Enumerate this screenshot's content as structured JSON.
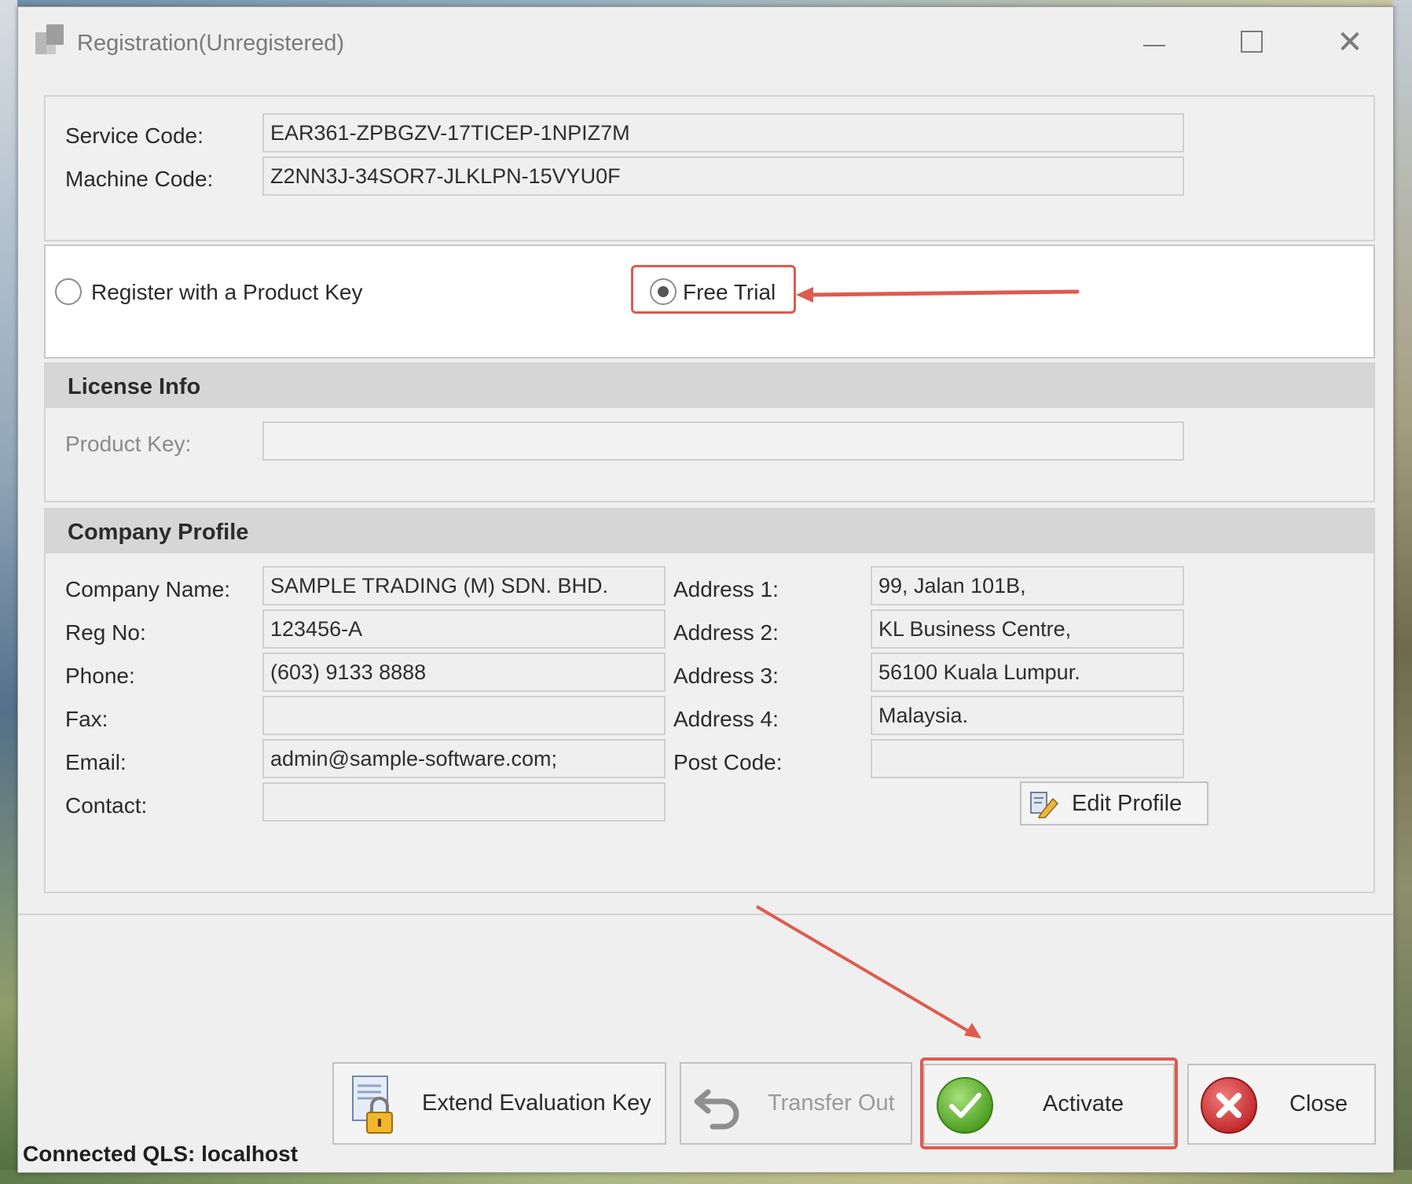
{
  "window": {
    "title": "Registration(Unregistered)",
    "controls": {
      "minimize": "—",
      "maximize": "☐",
      "close": "✕"
    }
  },
  "codes": {
    "service_code_label": "Service Code:",
    "service_code_value": "EAR361-ZPBGZV-17TICEP-1NPIZ7M",
    "machine_code_label": "Machine Code:",
    "machine_code_value": "Z2NN3J-34SOR7-JLKLPN-15VYU0F"
  },
  "registration_mode": {
    "options": [
      {
        "label": "Register with a Product Key",
        "selected": false
      },
      {
        "label": "Free Trial",
        "selected": true
      }
    ]
  },
  "license_info": {
    "header": "License Info",
    "product_key_label": "Product Key:",
    "product_key_value": ""
  },
  "company_profile": {
    "header": "Company Profile",
    "left_fields": [
      {
        "label": "Company Name:",
        "value": "SAMPLE TRADING (M) SDN. BHD."
      },
      {
        "label": "Reg No:",
        "value": "123456-A"
      },
      {
        "label": "Phone:",
        "value": "(603) 9133 8888"
      },
      {
        "label": "Fax:",
        "value": ""
      },
      {
        "label": "Email:",
        "value": "admin@sample-software.com;"
      },
      {
        "label": "Contact:",
        "value": ""
      }
    ],
    "right_fields": [
      {
        "label": "Address 1:",
        "value": "99, Jalan 101B,"
      },
      {
        "label": "Address 2:",
        "value": "KL Business Centre,"
      },
      {
        "label": "Address 3:",
        "value": "56100 Kuala Lumpur."
      },
      {
        "label": "Address 4:",
        "value": "Malaysia."
      },
      {
        "label": "Post Code:",
        "value": ""
      }
    ],
    "edit_profile_label": "Edit Profile"
  },
  "buttons": {
    "extend_evaluation": "Extend Evaluation Key",
    "transfer_out": "Transfer Out",
    "activate": "Activate",
    "close": "Close"
  },
  "status": {
    "text": "Connected QLS: localhost"
  },
  "colors": {
    "annotation_red": "#e05a4f",
    "activate_green": "#5cb82e",
    "close_red": "#d9383a"
  },
  "icons": {
    "app": "app-icon",
    "edit_profile": "edit-pencil-icon",
    "extend": "document-lock-icon",
    "transfer": "undo-arrow-icon",
    "activate": "green-check-icon",
    "close": "red-x-icon"
  }
}
